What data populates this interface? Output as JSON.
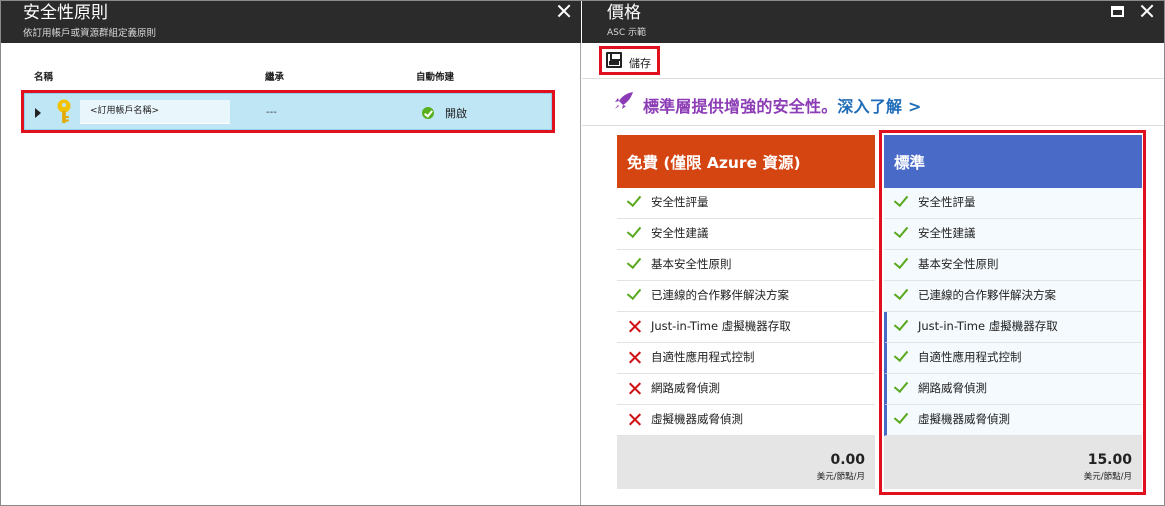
{
  "left_blade": {
    "title": "安全性原則",
    "subtitle": "依訂用帳戶或資源群組定義原則",
    "columns": {
      "name": "名稱",
      "inherit": "繼承",
      "provisioning": "自動佈建"
    },
    "row": {
      "name": "<訂用帳戶名稱>",
      "inherit": "---",
      "status": "開啟"
    }
  },
  "right_blade": {
    "title": "價格",
    "subtitle": "ASC 示範",
    "toolbar": {
      "save_label": "儲存"
    },
    "promo": {
      "text": "標準層提供增強的安全性。",
      "link": "深入了解 >"
    },
    "tiers": [
      {
        "name": "免費 (僅限 Azure 資源)",
        "color": "#d44512",
        "features": [
          {
            "label": "安全性評量",
            "included": true
          },
          {
            "label": "安全性建議",
            "included": true
          },
          {
            "label": "基本安全性原則",
            "included": true
          },
          {
            "label": "已連線的合作夥伴解決方案",
            "included": true
          },
          {
            "label": "Just-in-Time 虛擬機器存取",
            "included": false
          },
          {
            "label": "自適性應用程式控制",
            "included": false
          },
          {
            "label": "網路威脅偵測",
            "included": false
          },
          {
            "label": "虛擬機器威脅偵測",
            "included": false
          }
        ],
        "price": "0.00",
        "unit": "美元/節點/月"
      },
      {
        "name": "標準",
        "color": "#4a6ac8",
        "features": [
          {
            "label": "安全性評量",
            "included": true
          },
          {
            "label": "安全性建議",
            "included": true
          },
          {
            "label": "基本安全性原則",
            "included": true
          },
          {
            "label": "已連線的合作夥伴解決方案",
            "included": true
          },
          {
            "label": "Just-in-Time 虛擬機器存取",
            "included": true
          },
          {
            "label": "自適性應用程式控制",
            "included": true
          },
          {
            "label": "網路威脅偵測",
            "included": true
          },
          {
            "label": "虛擬機器威脅偵測",
            "included": true
          }
        ],
        "price": "15.00",
        "unit": "美元/節點/月"
      }
    ]
  },
  "colors": {
    "highlight_frame": "#e0101e",
    "row_selected": "#bfe6f5",
    "header_bg": "#2b2b2b",
    "promo_purple": "#8c3cb5",
    "link_blue": "#1f6cb8"
  }
}
